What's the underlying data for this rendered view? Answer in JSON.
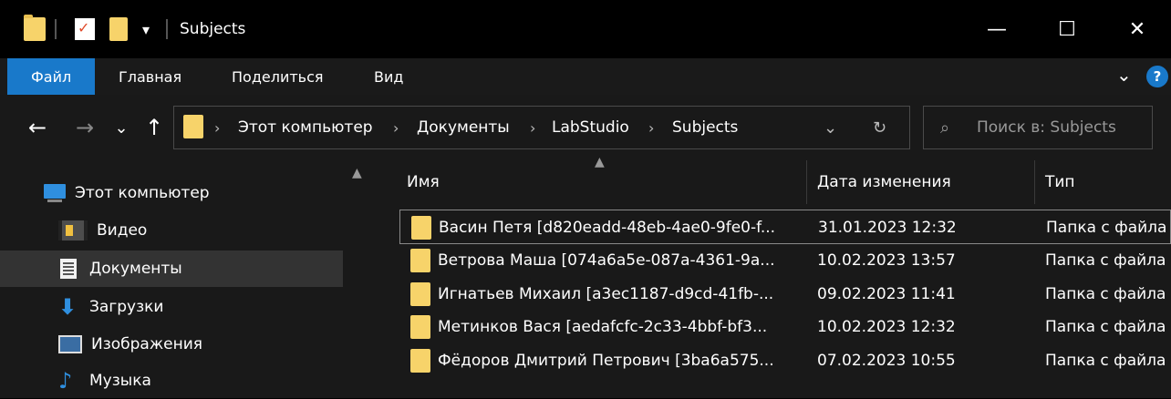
{
  "window": {
    "title": "Subjects",
    "quick_access_down": "▾",
    "minimize": "—",
    "maximize": "☐",
    "close": "✕"
  },
  "ribbon": {
    "tabs": [
      "Файл",
      "Главная",
      "Поделиться",
      "Вид"
    ],
    "expand": "⌄",
    "help": "?"
  },
  "nav": {
    "back": "←",
    "forward": "→",
    "recent": "⌄",
    "up": "↑",
    "dropdown": "⌄",
    "refresh": "↻"
  },
  "breadcrumb": [
    "Этот компьютер",
    "Документы",
    "LabStudio",
    "Subjects"
  ],
  "breadcrumb_sep": "›",
  "search": {
    "placeholder": "Поиск в: Subjects"
  },
  "sidebar": {
    "items": [
      {
        "label": "Этот компьютер",
        "icon": "computer-icon"
      },
      {
        "label": "Видео",
        "icon": "video-icon"
      },
      {
        "label": "Документы",
        "icon": "documents-icon",
        "selected": true
      },
      {
        "label": "Загрузки",
        "icon": "downloads-icon"
      },
      {
        "label": "Изображения",
        "icon": "pictures-icon"
      },
      {
        "label": "Музыка",
        "icon": "music-icon"
      }
    ]
  },
  "table": {
    "columns": [
      "Имя",
      "Дата изменения",
      "Тип"
    ],
    "rows": [
      {
        "name": "Васин Петя [d820eadd-48eb-4ae0-9fe0-f...",
        "date": "31.01.2023 12:32",
        "type": "Папка с файла"
      },
      {
        "name": "Ветрова Маша [074a6a5e-087a-4361-9a...",
        "date": "10.02.2023 13:57",
        "type": "Папка с файла"
      },
      {
        "name": "Игнатьев Михаил [a3ec1187-d9cd-41fb-...",
        "date": "09.02.2023 11:41",
        "type": "Папка с файла"
      },
      {
        "name": "Метинков Вася [aedafcfc-2c33-4bbf-bf3...",
        "date": "10.02.2023 12:32",
        "type": "Папка с файла"
      },
      {
        "name": "Фёдоров Дмитрий Петрович [3ba6a575...",
        "date": "07.02.2023 10:55",
        "type": "Папка с файла"
      }
    ]
  },
  "colors": {
    "accent": "#1979ca",
    "folder": "#f7d36a",
    "background": "#191919"
  }
}
